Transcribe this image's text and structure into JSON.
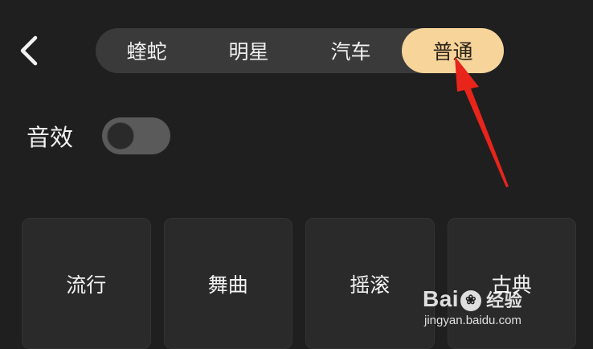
{
  "nav": {
    "back_icon": "chevron-left-icon"
  },
  "segments": {
    "tabs": [
      {
        "label": "蝰蛇",
        "active": false
      },
      {
        "label": "明星",
        "active": false
      },
      {
        "label": "汽车",
        "active": false
      },
      {
        "label": "普通",
        "active": true
      }
    ],
    "active_color": "#f7d49a"
  },
  "sound_effect": {
    "label": "音效",
    "enabled": false
  },
  "presets": [
    {
      "label": "流行"
    },
    {
      "label": "舞曲"
    },
    {
      "label": "摇滚"
    },
    {
      "label": "古典"
    }
  ],
  "annotation": {
    "arrow_color": "#e8241b"
  },
  "watermark": {
    "logo_left": "Bai",
    "logo_right": "经验",
    "url": "jingyan.baidu.com"
  }
}
